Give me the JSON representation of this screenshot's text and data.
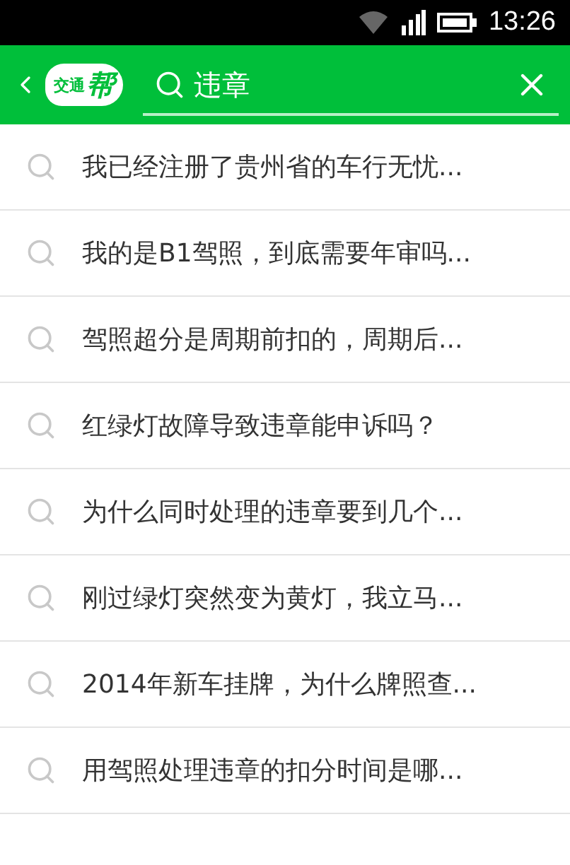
{
  "status_bar": {
    "time": "13:26"
  },
  "header": {
    "logo": [
      "交通",
      "帮"
    ],
    "search": {
      "value": "违章"
    }
  },
  "suggestions": [
    {
      "text": "我已经注册了贵州省的车行无忧..."
    },
    {
      "text": "我的是B1驾照，到底需要年审吗..."
    },
    {
      "text": "驾照超分是周期前扣的，周期后..."
    },
    {
      "text": "红绿灯故障导致违章能申诉吗？"
    },
    {
      "text": "为什么同时处理的违章要到几个..."
    },
    {
      "text": "刚过绿灯突然变为黄灯，我立马..."
    },
    {
      "text": "2014年新车挂牌，为什么牌照查..."
    },
    {
      "text": "用驾照处理违章的扣分时间是哪..."
    }
  ]
}
